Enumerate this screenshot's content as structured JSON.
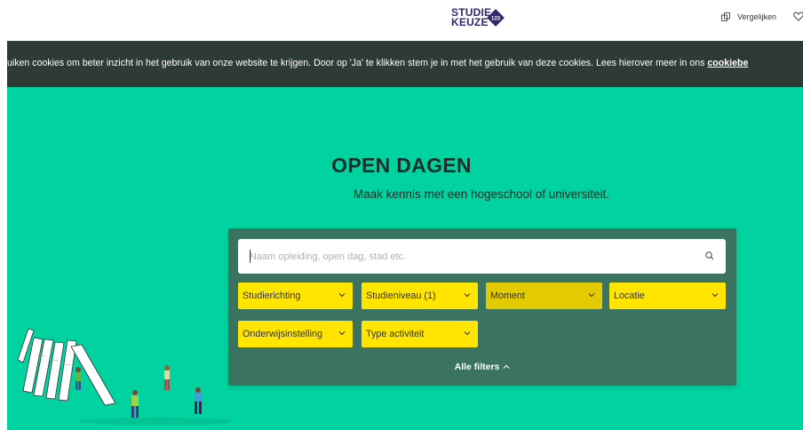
{
  "header": {
    "logo_line1": "STUDIE",
    "logo_line2": "KEUZE",
    "logo_badge": "123",
    "compare_label": "Vergelijken"
  },
  "cookie_bar": {
    "text": "uiken cookies om beter inzicht in het gebruik van onze website te krijgen. Door op 'Ja' te klikken stem je in met het gebruik van deze cookies. Lees hierover meer in ons ",
    "link": "cookiebe"
  },
  "hero": {
    "title": "OPEN DAGEN",
    "subtitle": "Maak kennis met een hogeschool of universiteit."
  },
  "search": {
    "placeholder": "Naam opleiding, open dag, stad etc."
  },
  "filters": [
    {
      "label": "Studierichting"
    },
    {
      "label": "Studieniveau (1)"
    },
    {
      "label": "Moment"
    },
    {
      "label": "Locatie"
    },
    {
      "label": "Onderwijsinstelling"
    },
    {
      "label": "Type activiteit"
    }
  ],
  "all_filters_label": "Alle filters",
  "colors": {
    "hero_bg": "#00d3a0",
    "panel_bg": "#3a7460",
    "filter_bg": "#ffe500",
    "filter_active_bg": "#e2cb00",
    "cookie_bg": "#2e3a34",
    "brand": "#2d2a6e"
  },
  "icons": {
    "compare": "compare-icon",
    "heart": "heart-icon",
    "search": "search-icon",
    "chevron": "chevron-down-icon",
    "chevron_up": "chevron-up-icon"
  }
}
